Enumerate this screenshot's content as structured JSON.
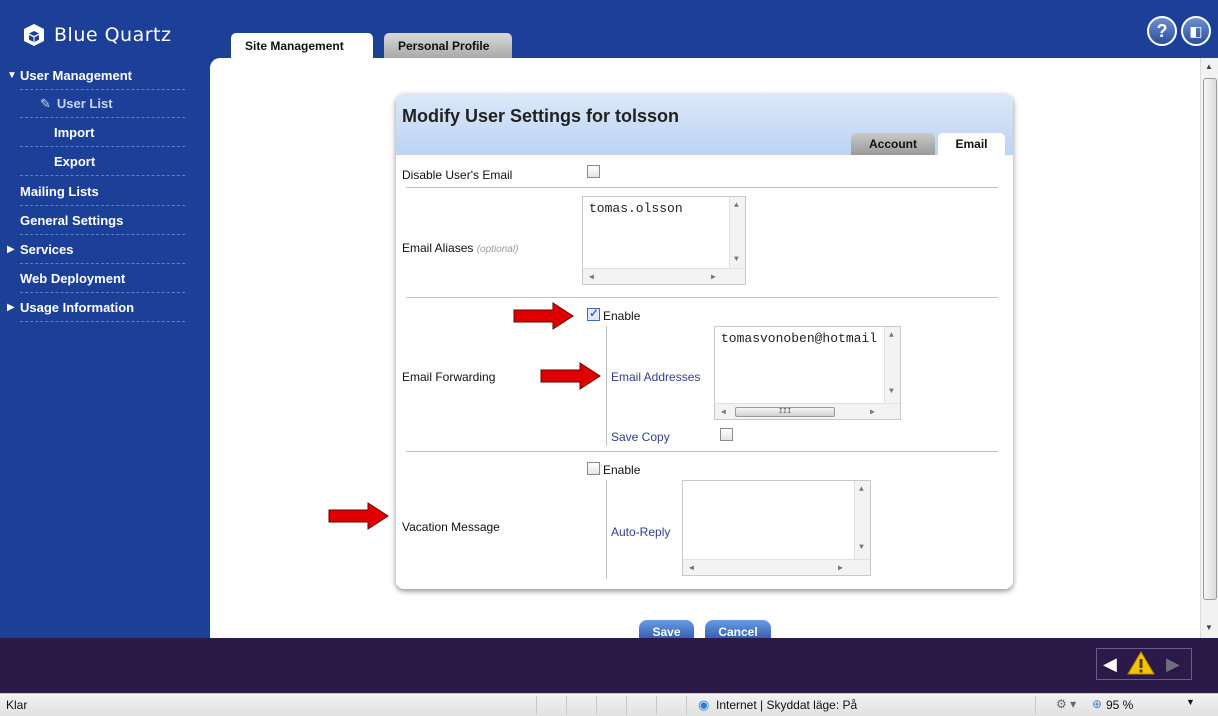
{
  "app": {
    "logo_text": "Blue Quartz"
  },
  "top_tabs": [
    {
      "label": "Site Management",
      "active": true
    },
    {
      "label": "Personal Profile",
      "active": false
    }
  ],
  "header_icons": [
    "help-icon",
    "logout-icon"
  ],
  "sidebar": {
    "items": [
      {
        "label": "User Management",
        "expanded": true
      },
      {
        "label": "User List",
        "active": true
      },
      {
        "label": "Import"
      },
      {
        "label": "Export"
      },
      {
        "label": "Mailing Lists"
      },
      {
        "label": "General Settings"
      },
      {
        "label": "Services",
        "expanded": false
      },
      {
        "label": "Web Deployment"
      },
      {
        "label": "Usage Information",
        "expanded": false
      }
    ]
  },
  "panel": {
    "title": "Modify User Settings for tolsson",
    "tabs": [
      {
        "label": "Account",
        "active": false
      },
      {
        "label": "Email",
        "active": true
      }
    ],
    "disable_email": {
      "label": "Disable User's Email",
      "checked": false
    },
    "aliases": {
      "label": "Email Aliases",
      "optional": "(optional)",
      "value": "tomas.olsson"
    },
    "forwarding": {
      "label": "Email Forwarding",
      "enable_label": "Enable",
      "enabled": true,
      "addresses_label": "Email Addresses",
      "addresses_value": "tomasvonoben@hotmail",
      "save_copy_label": "Save Copy",
      "save_copy": false
    },
    "vacation": {
      "label": "Vacation Message",
      "enable_label": "Enable",
      "enabled": false,
      "auto_reply_label": "Auto-Reply",
      "auto_reply_value": ""
    }
  },
  "buttons": {
    "save": "Save",
    "cancel": "Cancel"
  },
  "statusbar": {
    "left": "Klar",
    "zone": "Internet | Skyddat läge: På",
    "zoom": "95 %"
  },
  "colors": {
    "brand_blue": "#1c4097",
    "bottom_band": "#2b1947",
    "arrow_red": "#e00000"
  }
}
